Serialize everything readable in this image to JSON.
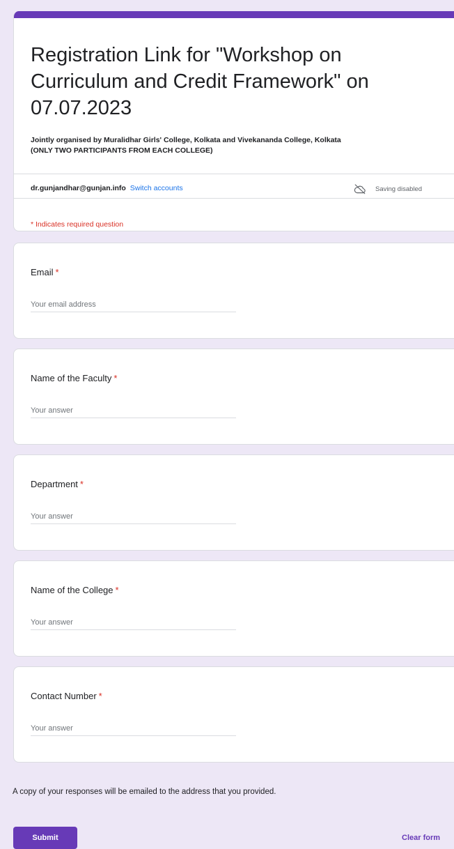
{
  "form": {
    "accent_color": "#673ab7",
    "title": "Registration Link for \"Workshop on Curriculum and Credit Framework\" on 07.07.2023",
    "description_line1": "Jointly organised by Muralidhar Girls' College, Kolkata and Vivekananda College, Kolkata",
    "description_line2": "(ONLY TWO PARTICIPANTS FROM EACH COLLEGE)"
  },
  "account": {
    "email": "dr.gunjandhar@gunjan.info",
    "switch_label": "Switch accounts",
    "saving_status": "Saving disabled",
    "saving_icon": "cloud-off-icon"
  },
  "required_note": "* Indicates required question",
  "questions": [
    {
      "label": "Email",
      "placeholder": "Your email address",
      "required": true
    },
    {
      "label": "Name of the Faculty",
      "placeholder": "Your answer",
      "required": true
    },
    {
      "label": "Department",
      "placeholder": "Your answer",
      "required": true
    },
    {
      "label": "Name of the College",
      "placeholder": "Your answer",
      "required": true
    },
    {
      "label": "Contact Number",
      "placeholder": "Your answer",
      "required": true
    }
  ],
  "required_marker": "*",
  "footer": {
    "copy_note": "A copy of your responses will be emailed to the address that you provided.",
    "submit_label": "Submit",
    "clear_label": "Clear form"
  }
}
